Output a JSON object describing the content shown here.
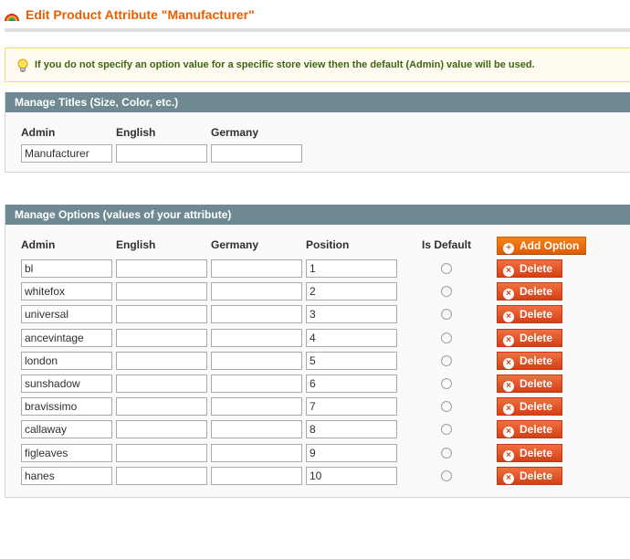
{
  "page": {
    "title": "Edit Product Attribute \"Manufacturer\"",
    "notice": "If you do not specify an option value for a specific store view then the default (Admin) value will be used."
  },
  "titles_section": {
    "legend": "Manage Titles (Size, Color, etc.)",
    "columns": [
      "Admin",
      "English",
      "Germany"
    ],
    "values": [
      "Manufacturer",
      "",
      ""
    ]
  },
  "options_section": {
    "legend": "Manage Options (values of your attribute)",
    "columns": [
      "Admin",
      "English",
      "Germany",
      "Position",
      "Is Default"
    ],
    "add_label": "Add Option",
    "delete_label": "Delete",
    "rows": [
      {
        "admin": "bl",
        "english": "",
        "germany": "",
        "position": "1",
        "is_default": false
      },
      {
        "admin": "whitefox",
        "english": "",
        "germany": "",
        "position": "2",
        "is_default": false
      },
      {
        "admin": "universal",
        "english": "",
        "germany": "",
        "position": "3",
        "is_default": false
      },
      {
        "admin": "ancevintage",
        "english": "",
        "germany": "",
        "position": "4",
        "is_default": false
      },
      {
        "admin": "london",
        "english": "",
        "germany": "",
        "position": "5",
        "is_default": false
      },
      {
        "admin": "sunshadow",
        "english": "",
        "germany": "",
        "position": "6",
        "is_default": false
      },
      {
        "admin": "bravissimo",
        "english": "",
        "germany": "",
        "position": "7",
        "is_default": false
      },
      {
        "admin": "callaway",
        "english": "",
        "germany": "",
        "position": "8",
        "is_default": false
      },
      {
        "admin": "figleaves",
        "english": "",
        "germany": "",
        "position": "9",
        "is_default": false
      },
      {
        "admin": "hanes",
        "english": "",
        "germany": "",
        "position": "10",
        "is_default": false
      }
    ]
  },
  "colors": {
    "title": "#eb5e00",
    "section_header": "#6f8992",
    "button": "#e05a00",
    "notice_text": "#3d6611"
  },
  "icons": {
    "header_logo": "rainbow-icon",
    "notice_icon": "lightbulb-icon",
    "add_icon": "plus-circle-icon",
    "delete_icon": "x-circle-icon"
  }
}
